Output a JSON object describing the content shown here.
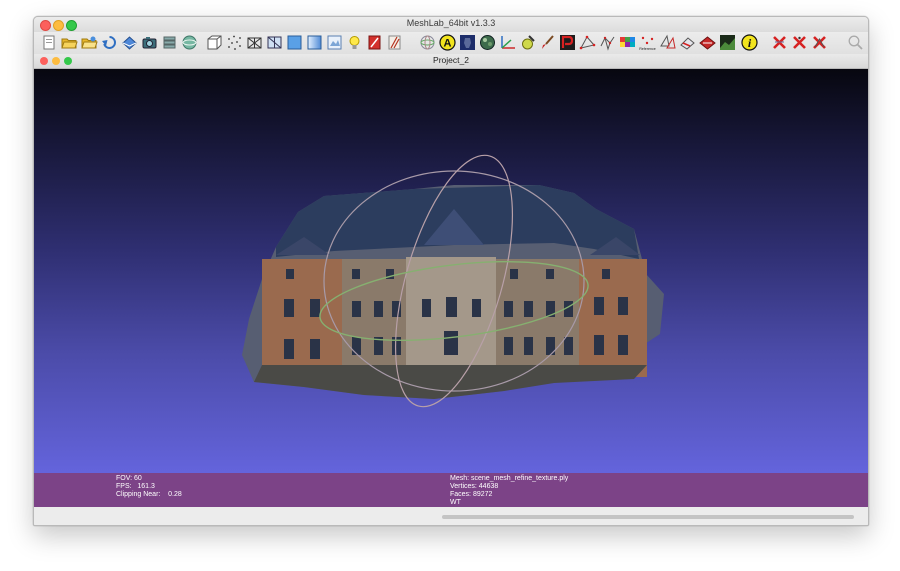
{
  "window": {
    "title": "MeshLab_64bit v1.3.3"
  },
  "toolbar": {
    "icons": [
      "new-project-icon",
      "open-folder-icon",
      "open-file-icon",
      "reload-icon",
      "export-icon",
      "snapshot-icon",
      "layers-icon",
      "sphere-icon",
      "bounding-box-icon",
      "points-icon",
      "wireframe-icon",
      "hidden-lines-icon",
      "flat-shading-icon",
      "smooth-shading-icon",
      "texture-icon",
      "light-icon",
      "color-red-icon",
      "color-pencil-icon",
      "trackball-icon",
      "annotation-a-icon",
      "vase-icon",
      "texture-ball-icon",
      "axis-icon",
      "paint-bucket-icon",
      "brush-icon",
      "pick-points-icon",
      "select-vertices-icon",
      "select-connected-icon",
      "color-picker-icon",
      "reference-icon",
      "align-icon",
      "measure-icon",
      "cut-icon",
      "raster-icon",
      "info-icon",
      "delete-faces-icon",
      "delete-vertices-icon",
      "delete-selection-icon",
      "search-icon"
    ],
    "annotation_letter": "A",
    "info_letter": "i",
    "reference_label": "Reference"
  },
  "subwindow": {
    "title": "Project_2"
  },
  "info_left": {
    "fov": "FOV: 60",
    "fps": "FPS:   161.3",
    "clipping": "Clipping Near:    0.28"
  },
  "info_right": {
    "mesh": "Mesh: scene_mesh_refine_texture.ply",
    "vertices": "Vertices: 44638",
    "faces": "Faces: 89272",
    "mode": "WT"
  },
  "colors": {
    "viewport_top": "#07070f",
    "viewport_bottom": "#6464dc",
    "info_bar": "#7c4387",
    "trackball_ring": "#a89aa8",
    "trackball_equator": "#86b070"
  }
}
